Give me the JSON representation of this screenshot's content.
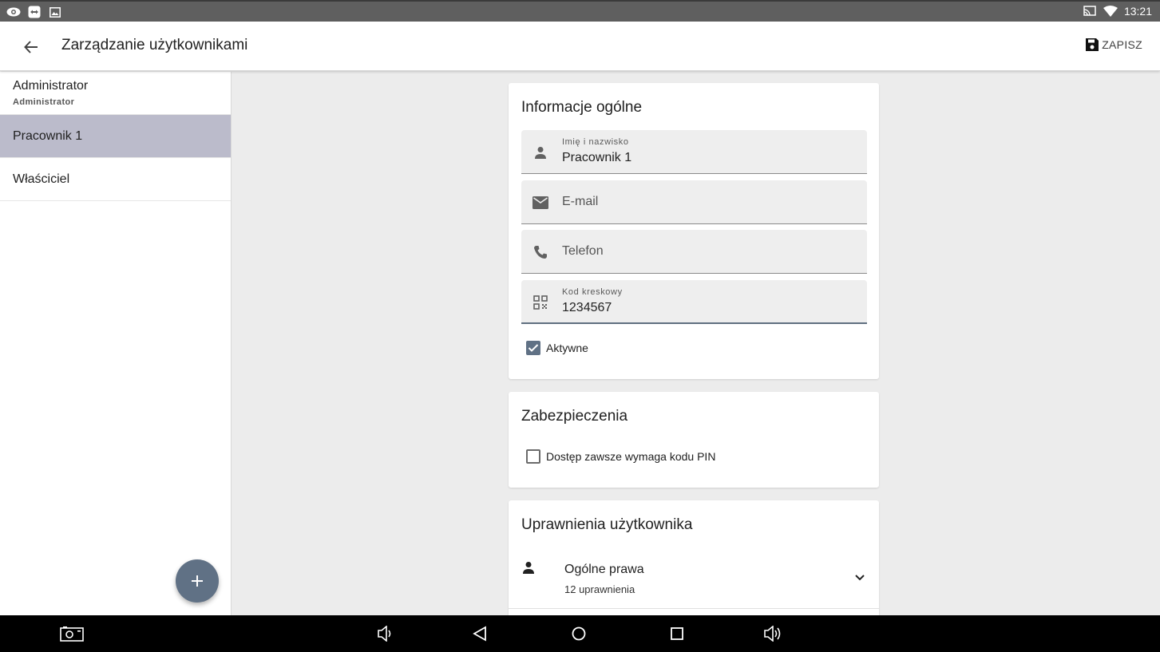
{
  "status_bar": {
    "time": "13:21",
    "left_icons": [
      "eye-icon",
      "teamviewer-icon",
      "image-icon"
    ],
    "right_icons": [
      "cast-icon",
      "wifi-icon"
    ]
  },
  "app_bar": {
    "title": "Zarządzanie użytkownikami",
    "save_label": "ZAPISZ"
  },
  "users": [
    {
      "name": "Administrator",
      "role": "Administrator",
      "selected": false
    },
    {
      "name": "Pracownik 1",
      "role": "",
      "selected": true
    },
    {
      "name": "Właściciel",
      "role": "",
      "selected": false
    }
  ],
  "general_info": {
    "title": "Informacje ogólne",
    "fields": {
      "name": {
        "label": "Imię i nazwisko",
        "value": "Pracownik 1"
      },
      "email": {
        "placeholder": "E-mail"
      },
      "phone": {
        "placeholder": "Telefon"
      },
      "barcode": {
        "label": "Kod kreskowy",
        "value": "1234567"
      }
    },
    "active_label": "Aktywne",
    "active_checked": true
  },
  "security": {
    "title": "Zabezpieczenia",
    "pin_label": "Dostęp zawsze wymaga kodu PIN",
    "pin_checked": false
  },
  "permissions": {
    "title": "Uprawnienia użytkownika",
    "items": [
      {
        "title": "Ogólne prawa",
        "subtitle": "12 uprawnienia"
      }
    ]
  },
  "colors": {
    "accent": "#607185",
    "selected_row": "#bbbbcb"
  }
}
